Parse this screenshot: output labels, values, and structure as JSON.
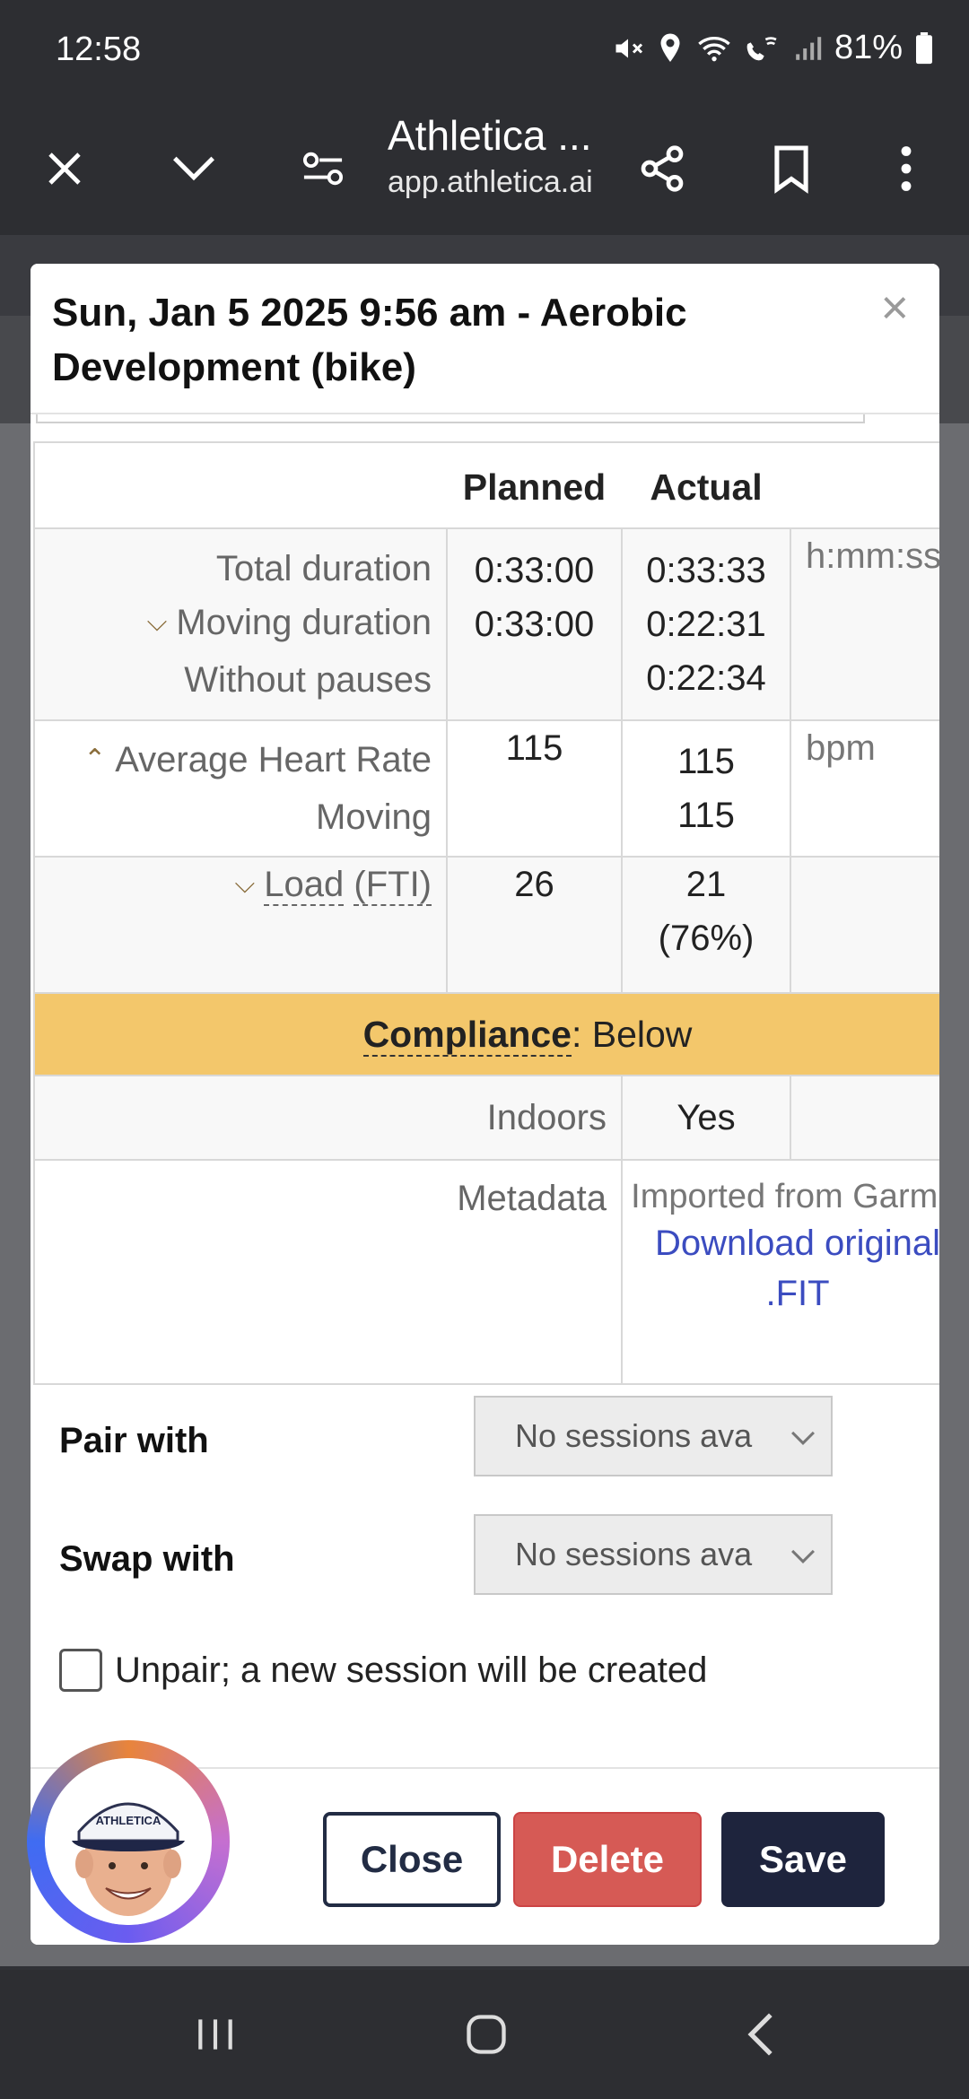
{
  "status_bar": {
    "time": "12:58",
    "battery": "81%",
    "icons": [
      "mute-icon",
      "location-icon",
      "wifi-icon",
      "wifi-call-icon",
      "signal-icon",
      "battery-icon"
    ]
  },
  "browser": {
    "title": "Athletica ...",
    "url": "app.athletica.ai",
    "icons": [
      "close-icon",
      "chevron-down-icon",
      "site-settings-icon",
      "share-icon",
      "bookmark-icon",
      "more-icon"
    ]
  },
  "modal": {
    "title": "Sun, Jan 5 2025 9:56 am - Aerobic Development (bike)",
    "close_symbol": "×"
  },
  "table": {
    "headers": {
      "planned": "Planned",
      "actual": "Actual"
    },
    "duration": {
      "labels": [
        "Total duration",
        "Moving duration",
        "Without pauses"
      ],
      "planned": [
        "0:33:00",
        "0:33:00"
      ],
      "actual": [
        "0:33:33",
        "0:22:31",
        "0:22:34"
      ],
      "unit": "h:mm:ss"
    },
    "heart_rate": {
      "labels": [
        "Average Heart Rate",
        "Moving"
      ],
      "planned": "115",
      "actual": [
        "115",
        "115"
      ],
      "unit": "bpm"
    },
    "load": {
      "label_main": "Load",
      "label_paren": "(FTI)",
      "planned": "26",
      "actual": "21",
      "actual_pct": "(76%)"
    },
    "compliance": {
      "label": "Compliance",
      "value": ": Below",
      "color": "#f3c76b"
    },
    "indoors": {
      "label": "Indoors",
      "value": "Yes"
    },
    "metadata": {
      "label": "Metadata",
      "text": "Imported from Garmin",
      "link": "Download original .FIT"
    }
  },
  "pair_with": {
    "label": "Pair with",
    "selected": "No sessions ava"
  },
  "swap_with": {
    "label": "Swap with",
    "selected": "No sessions ava"
  },
  "unpair": {
    "label": "Unpair; a new session will be created",
    "checked": false
  },
  "footer": {
    "close_label": "Close",
    "delete_label": "Delete",
    "save_label": "Save"
  },
  "avatar": {
    "cap_text": "ATHLETICA"
  },
  "colors": {
    "accent": "#1e243d",
    "danger": "#d65a55",
    "link": "#3b4cc0"
  }
}
